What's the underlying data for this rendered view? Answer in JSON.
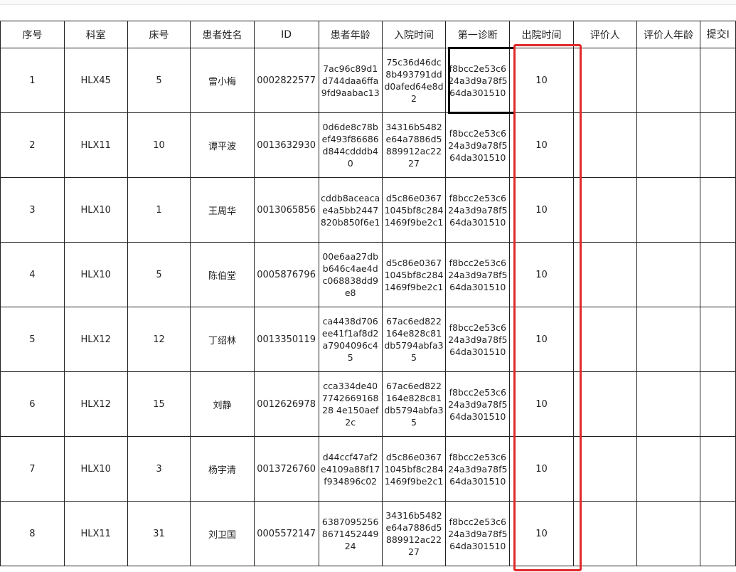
{
  "table": {
    "headers": [
      "序号",
      "科室",
      "床号",
      "患者姓名",
      "ID",
      "患者年龄",
      "入院时间",
      "第一诊断",
      "出院时间",
      "评价人",
      "评价人年龄",
      "提交I"
    ],
    "rows": [
      {
        "no": "1",
        "dept": "HLX45",
        "bed": "5",
        "name": "雷小梅",
        "id": "0002822577",
        "age": "7ac96c89d1d744daa6ffa9fd9aabac13",
        "admit": "75c36d46dc8b493791ddd0afed64e8d2",
        "diag": "f8bcc2e53c624a3d9a78f564da301510",
        "discharge": "10",
        "reviewer": "",
        "reviewer_age": "",
        "submit": ""
      },
      {
        "no": "2",
        "dept": "HLX11",
        "bed": "10",
        "name": "谭平波",
        "id": "0013632930",
        "age": "0d6de8c78bef493f86686d844cdddb40",
        "admit": "34316b5482e64a7886d5889912ac2227",
        "diag": "f8bcc2e53c624a3d9a78f564da301510",
        "discharge": "10",
        "reviewer": "",
        "reviewer_age": "",
        "submit": ""
      },
      {
        "no": "3",
        "dept": "HLX10",
        "bed": "1",
        "name": "王周华",
        "id": "0013065856",
        "age": "cddb8aceacae4a5bb2447820b850f6e1",
        "admit": "d5c86e03671045bf8c2841469f9be2c1",
        "diag": "f8bcc2e53c624a3d9a78f564da301510",
        "discharge": "10",
        "reviewer": "",
        "reviewer_age": "",
        "submit": ""
      },
      {
        "no": "4",
        "dept": "HLX10",
        "bed": "5",
        "name": "陈伯堂",
        "id": "0005876796",
        "age": "00e6aa27dbb646c4ae4dc068838dd9e8",
        "admit": "d5c86e03671045bf8c2841469f9be2c1",
        "diag": "f8bcc2e53c624a3d9a78f564da301510",
        "discharge": "10",
        "reviewer": "",
        "reviewer_age": "",
        "submit": ""
      },
      {
        "no": "5",
        "dept": "HLX12",
        "bed": "12",
        "name": "丁绍林",
        "id": "0013350119",
        "age": "ca4438d706ee41f1af8d2a7904096c45",
        "admit": "67ac6ed822164e828c81db5794abfa35",
        "diag": "f8bcc2e53c624a3d9a78f564da301510",
        "discharge": "10",
        "reviewer": "",
        "reviewer_age": "",
        "submit": ""
      },
      {
        "no": "6",
        "dept": "HLX12",
        "bed": "15",
        "name": "刘静",
        "id": "0012626978",
        "age": "cca334de40774266916828 4e150aef2c",
        "admit": "67ac6ed822164e828c81db5794abfa35",
        "diag": "f8bcc2e53c624a3d9a78f564da301510",
        "discharge": "10",
        "reviewer": "",
        "reviewer_age": "",
        "submit": ""
      },
      {
        "no": "7",
        "dept": "HLX10",
        "bed": "3",
        "name": "杨宇清",
        "id": "0013726760",
        "age": "d44ccf47af2e4109a88f17f934896c02",
        "admit": "d5c86e03671045bf8c2841469f9be2c1",
        "diag": "f8bcc2e53c624a3d9a78f564da301510",
        "discharge": "10",
        "reviewer": "",
        "reviewer_age": "",
        "submit": ""
      },
      {
        "no": "8",
        "dept": "HLX11",
        "bed": "31",
        "name": "刘卫国",
        "id": "0005572147",
        "age": "6387095256867145244924",
        "admit": "34316b5482e64a7886d5889912ac2227",
        "diag": "f8bcc2e53c624a3d9a78f564da301510",
        "discharge": "10",
        "reviewer": "",
        "reviewer_age": "",
        "submit": ""
      }
    ]
  }
}
